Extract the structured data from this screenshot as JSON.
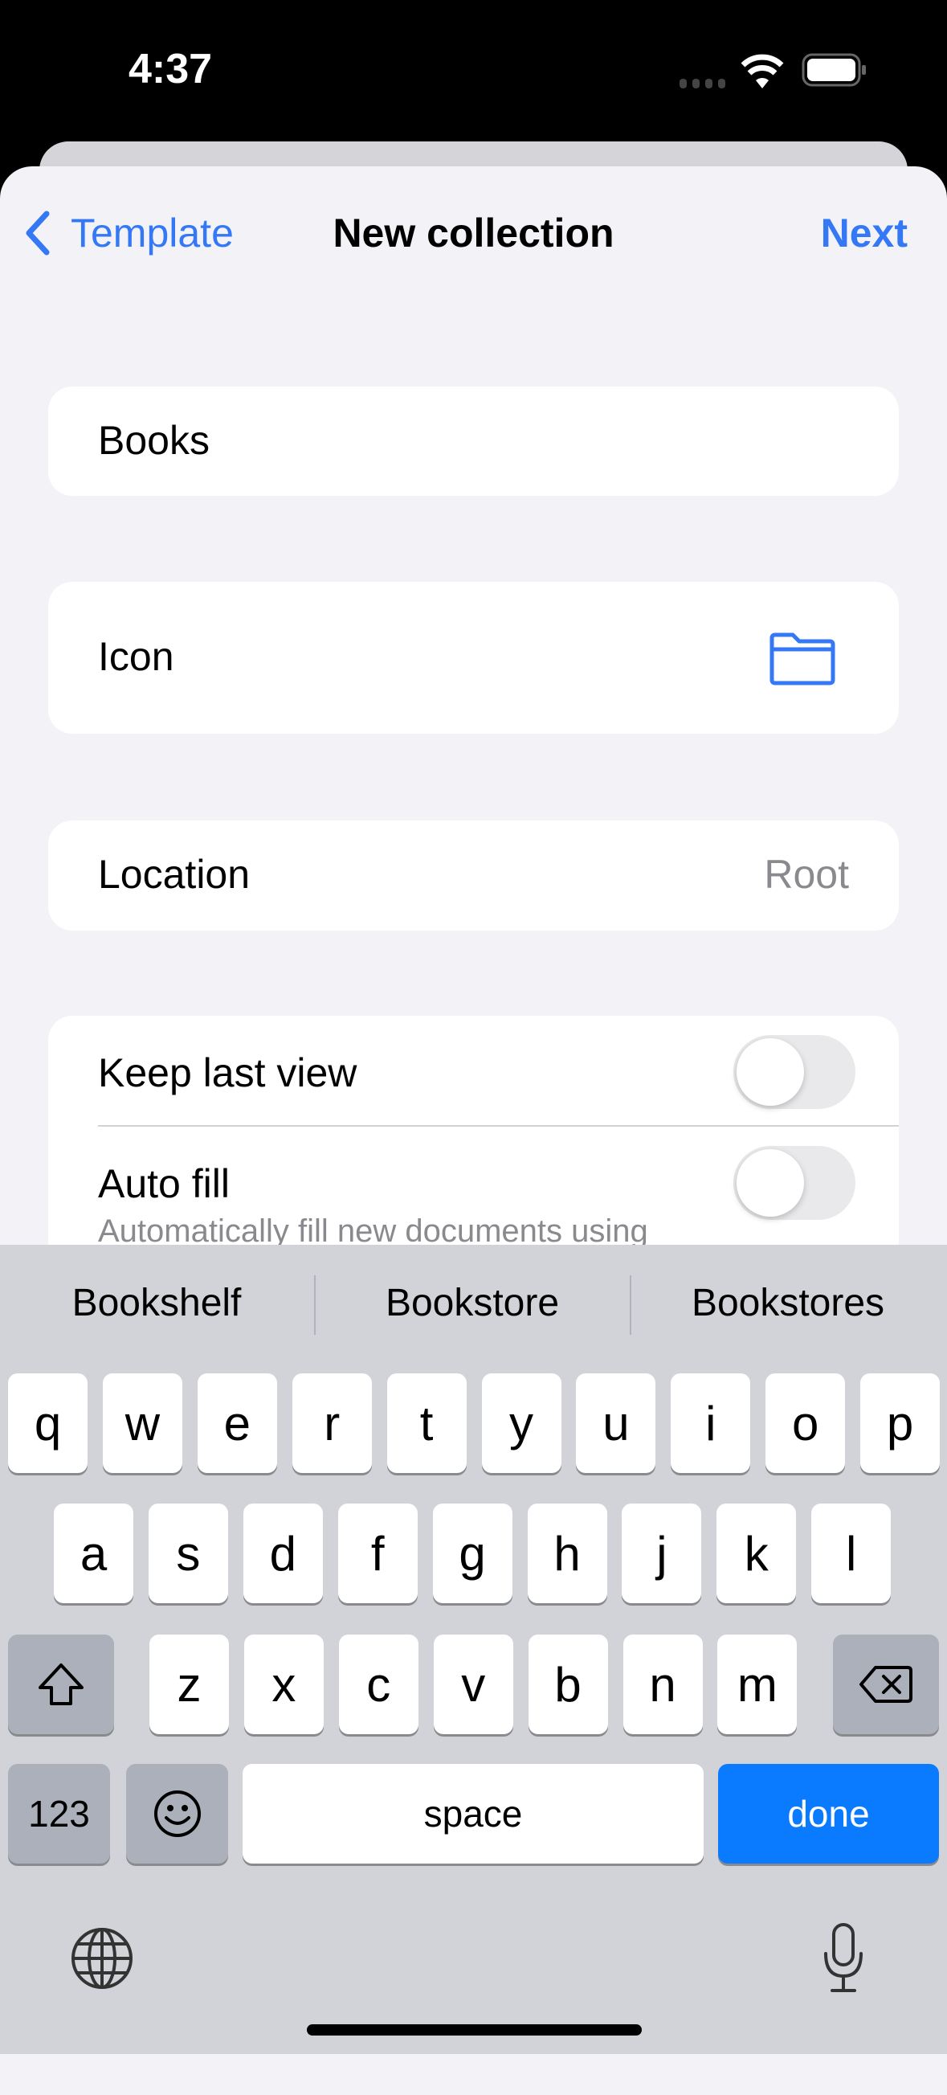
{
  "status": {
    "time": "4:37"
  },
  "nav": {
    "back_label": "Template",
    "title": "New collection",
    "next_label": "Next"
  },
  "form": {
    "name_value": "Books",
    "icon_label": "Icon",
    "icon_value": "folder-icon",
    "location_label": "Location",
    "location_value": "Root",
    "keep_last_view_label": "Keep last view",
    "keep_last_view_on": false,
    "auto_fill_label": "Auto fill",
    "auto_fill_desc": "Automatically fill new documents using",
    "auto_fill_on": false
  },
  "keyboard": {
    "suggestions": [
      "Bookshelf",
      "Bookstore",
      "Bookstores"
    ],
    "row1": [
      "q",
      "w",
      "e",
      "r",
      "t",
      "y",
      "u",
      "i",
      "o",
      "p"
    ],
    "row2": [
      "a",
      "s",
      "d",
      "f",
      "g",
      "h",
      "j",
      "k",
      "l"
    ],
    "row3": [
      "z",
      "x",
      "c",
      "v",
      "b",
      "n",
      "m"
    ],
    "numbers_label": "123",
    "space_label": "space",
    "done_label": "done"
  },
  "colors": {
    "accent": "#3478f6",
    "done_key": "#0a7aff"
  }
}
